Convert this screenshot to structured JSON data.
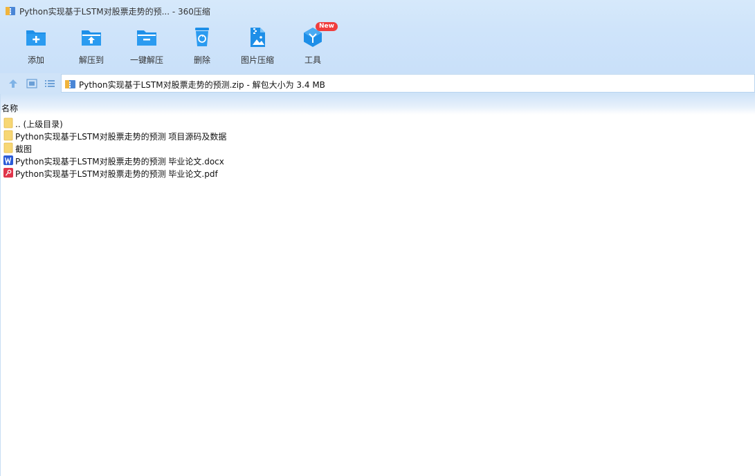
{
  "window": {
    "title": "Python实现基于LSTM对股票走势的预... - 360压缩"
  },
  "toolbar": {
    "add_label": "添加",
    "extract_to_label": "解压到",
    "one_click_extract_label": "一键解压",
    "delete_label": "删除",
    "image_compress_label": "图片压缩",
    "tools_label": "工具",
    "tools_badge": "New"
  },
  "address": {
    "path": "Python实现基于LSTM对股票走势的预测.zip - 解包大小为 3.4 MB"
  },
  "list": {
    "column_name": "名称",
    "items": [
      {
        "name": ".. (上级目录)",
        "type": "folder"
      },
      {
        "name": "Python实现基于LSTM对股票走势的预测 项目源码及数据",
        "type": "folder"
      },
      {
        "name": "截图",
        "type": "folder"
      },
      {
        "name": "Python实现基于LSTM对股票走势的预测 毕业论文.docx",
        "type": "docx"
      },
      {
        "name": "Python实现基于LSTM对股票走势的预测 毕业论文.pdf",
        "type": "pdf"
      }
    ]
  },
  "colors": {
    "accent_blue": "#1e8fe8",
    "badge_red": "#f03d3d",
    "folder_yellow": "#f7d774",
    "word_blue": "#2b5bd7",
    "pdf_red": "#e0354a"
  },
  "icons": {
    "app": "zip-archive-icon",
    "add": "folder-add-icon",
    "extract_to": "folder-extract-icon",
    "one_click_extract": "folder-minus-icon",
    "delete": "recycle-bin-icon",
    "image_compress": "image-zip-icon",
    "tools": "tools-cube-icon",
    "up": "arrow-up-icon",
    "view_thumb": "thumbnail-view-icon",
    "view_list": "list-view-icon"
  }
}
